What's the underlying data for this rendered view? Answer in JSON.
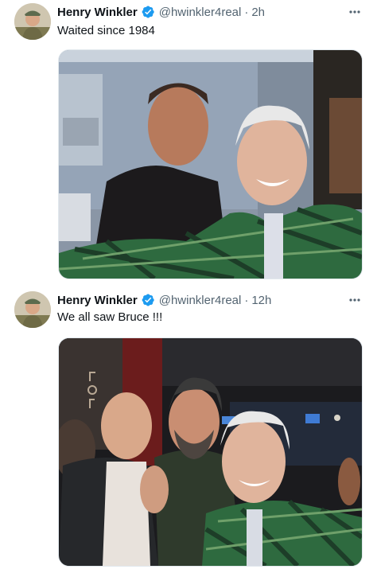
{
  "tweets": [
    {
      "display_name": "Henry Winkler",
      "handle": "@hwinkler4real",
      "separator": "·",
      "time": "2h",
      "text": "Waited since 1984",
      "more_icon": "more-horizontal-icon",
      "verified_icon": "verified-badge-icon"
    },
    {
      "display_name": "Henry Winkler",
      "handle": "@hwinkler4real",
      "separator": "·",
      "time": "12h",
      "text": "We all saw Bruce !!!",
      "more_icon": "more-horizontal-icon",
      "verified_icon": "verified-badge-icon"
    }
  ],
  "colors": {
    "verified": "#1d9bf0",
    "secondary_text": "#536471",
    "primary_text": "#0f1419"
  }
}
